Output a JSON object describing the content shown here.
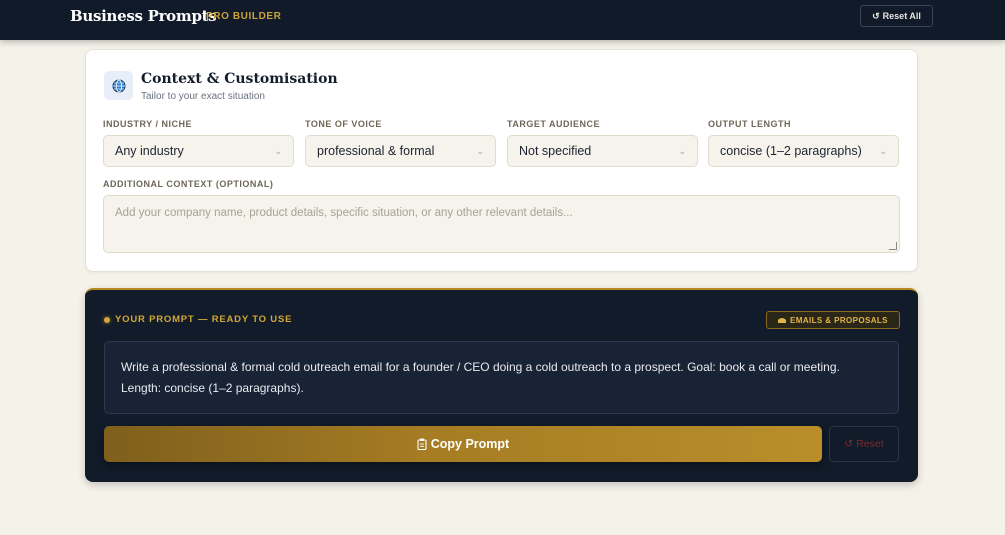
{
  "header": {
    "brand": "Business Prompts",
    "brand_sub": "PRO BUILDER",
    "reset_all_icon": "↺",
    "reset_all_label": "Reset All"
  },
  "context_card": {
    "icon": "globe-icon",
    "title": "Context & Customisation",
    "subtitle": "Tailor to your exact situation",
    "fields": [
      {
        "label": "INDUSTRY / NICHE",
        "value": "Any industry"
      },
      {
        "label": "TONE OF VOICE",
        "value": "professional & formal"
      },
      {
        "label": "TARGET AUDIENCE",
        "value": "Not specified"
      },
      {
        "label": "OUTPUT LENGTH",
        "value": "concise (1–2 paragraphs)"
      }
    ],
    "additional_context": {
      "label": "ADDITIONAL CONTEXT (OPTIONAL)",
      "placeholder": "Add your company name, product details, specific situation, or any other relevant details..."
    }
  },
  "prompt_panel": {
    "heading": "YOUR PROMPT — READY TO USE",
    "badge_label": "EMAILS & PROPOSALS",
    "prompt_text": "Write a professional & formal cold outreach email for a founder / CEO doing a cold outreach to a prospect. Goal: book a call or meeting. Length: concise (1–2 paragraphs).",
    "copy_label": "Copy Prompt",
    "reset_label": "Reset",
    "reset_icon": "↺"
  },
  "colors": {
    "accent": "#c9a23a",
    "navy": "#101a28",
    "background": "#f5f2ea"
  }
}
